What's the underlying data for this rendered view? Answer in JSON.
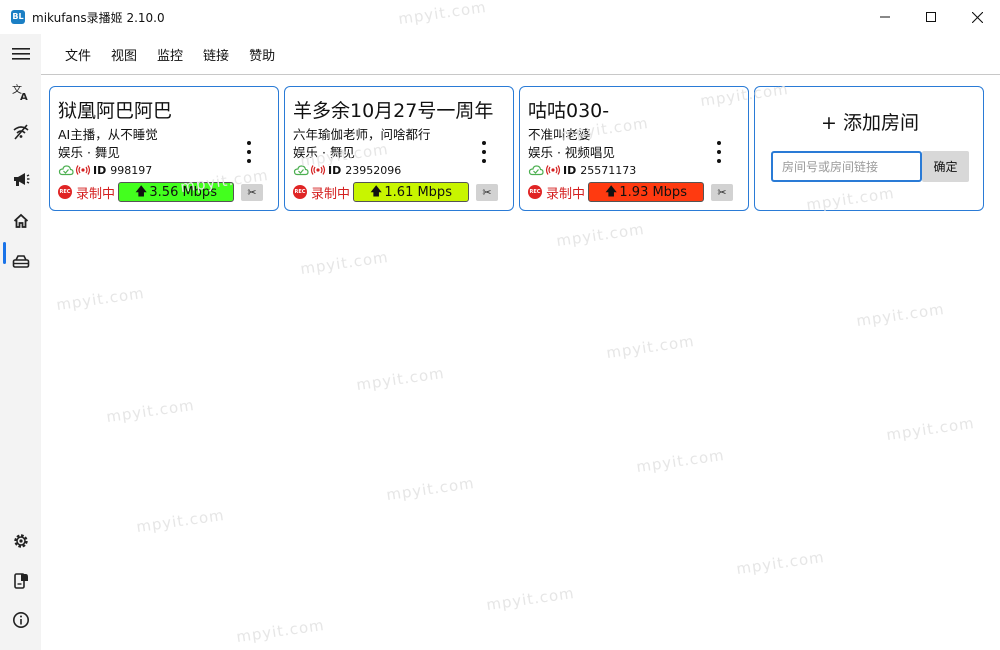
{
  "window": {
    "title": "mikufans录播姬 2.10.0",
    "icon_label": "BL",
    "controls": {
      "minimize": "—",
      "maximize": "☐",
      "close": "✕"
    }
  },
  "menu": {
    "items": [
      {
        "label": "文件"
      },
      {
        "label": "视图"
      },
      {
        "label": "监控"
      },
      {
        "label": "链接"
      },
      {
        "label": "赞助"
      }
    ]
  },
  "sidebar": {
    "items": [
      {
        "icon": "hamburger-menu-icon"
      },
      {
        "icon": "translate-icon"
      },
      {
        "icon": "no-wifi-icon"
      },
      {
        "icon": "megaphone-icon"
      },
      {
        "icon": "home-icon",
        "active": true
      },
      {
        "icon": "toolbox-icon"
      },
      {
        "icon": "settings-icon"
      },
      {
        "icon": "logs-icon"
      },
      {
        "icon": "info-icon"
      }
    ]
  },
  "rooms": [
    {
      "title": "狱凰阿巴阿巴",
      "desc": "AI主播，从不睡觉",
      "category": "娱乐 · 舞见",
      "id_label": "ID",
      "id": "998197",
      "rec_label": "录制中",
      "rec_icon_text": "REC",
      "speed": "3.56 Mbps",
      "speed_color": "#43ff1e",
      "cut_icon": "✂"
    },
    {
      "title": "羊多余10月27号一周年",
      "desc": "六年瑜伽老师，问啥都行",
      "category": "娱乐 · 舞见",
      "id_label": "ID",
      "id": "23952096",
      "rec_label": "录制中",
      "rec_icon_text": "REC",
      "speed": "1.61 Mbps",
      "speed_color": "#c8f500",
      "cut_icon": "✂"
    },
    {
      "title": "咕咕030-",
      "desc": "不准叫老婆",
      "category": "娱乐 · 视频唱见",
      "id_label": "ID",
      "id": "25571173",
      "rec_label": "录制中",
      "rec_icon_text": "REC",
      "speed": "1.93 Mbps",
      "speed_color": "#ff3a10",
      "cut_icon": "✂"
    }
  ],
  "add_room": {
    "title": "+ 添加房间",
    "placeholder": "房间号或房间链接",
    "confirm_label": "确定"
  },
  "watermark": "mpyit.com"
}
